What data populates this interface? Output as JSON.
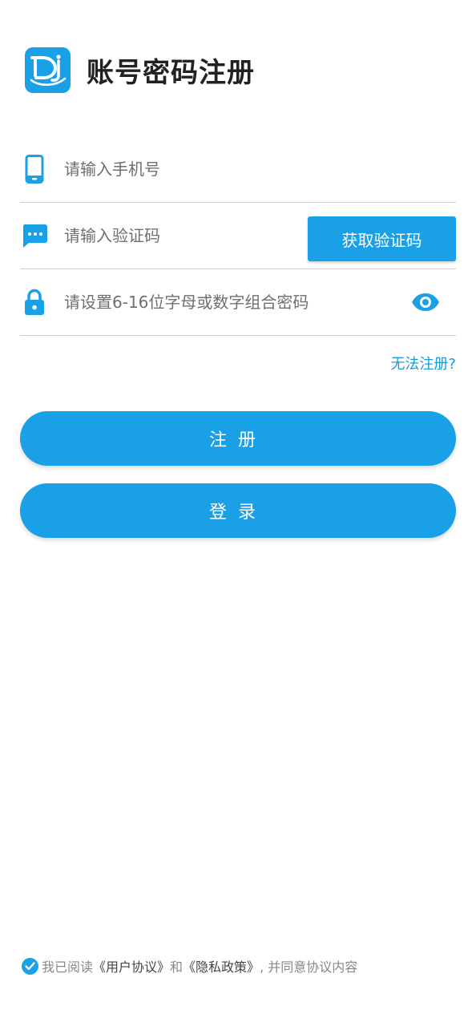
{
  "header": {
    "title": "账号密码注册",
    "logo_icon": "app-logo-icon"
  },
  "form": {
    "phone": {
      "placeholder": "请输入手机号",
      "value": "",
      "icon": "phone-icon"
    },
    "code": {
      "placeholder": "请输入验证码",
      "value": "",
      "icon": "message-icon",
      "button_label": "获取验证码"
    },
    "password": {
      "placeholder": "请设置6-16位字母或数字组合密码",
      "value": "",
      "icon": "lock-icon",
      "toggle_icon": "eye-icon"
    }
  },
  "help_link": "无法注册?",
  "buttons": {
    "register": "注册",
    "login": "登录"
  },
  "agreement": {
    "checked": true,
    "prefix": "我已阅读",
    "user_agreement": "《用户协议》",
    "and": "和",
    "privacy_policy": "《隐私政策》",
    "suffix": ", 并同意协议内容"
  },
  "colors": {
    "accent": "#1aa0e6",
    "title": "#222222",
    "placeholder": "#6f6f6f",
    "divider": "#cfcfcf",
    "link": "#1a9ad6"
  }
}
